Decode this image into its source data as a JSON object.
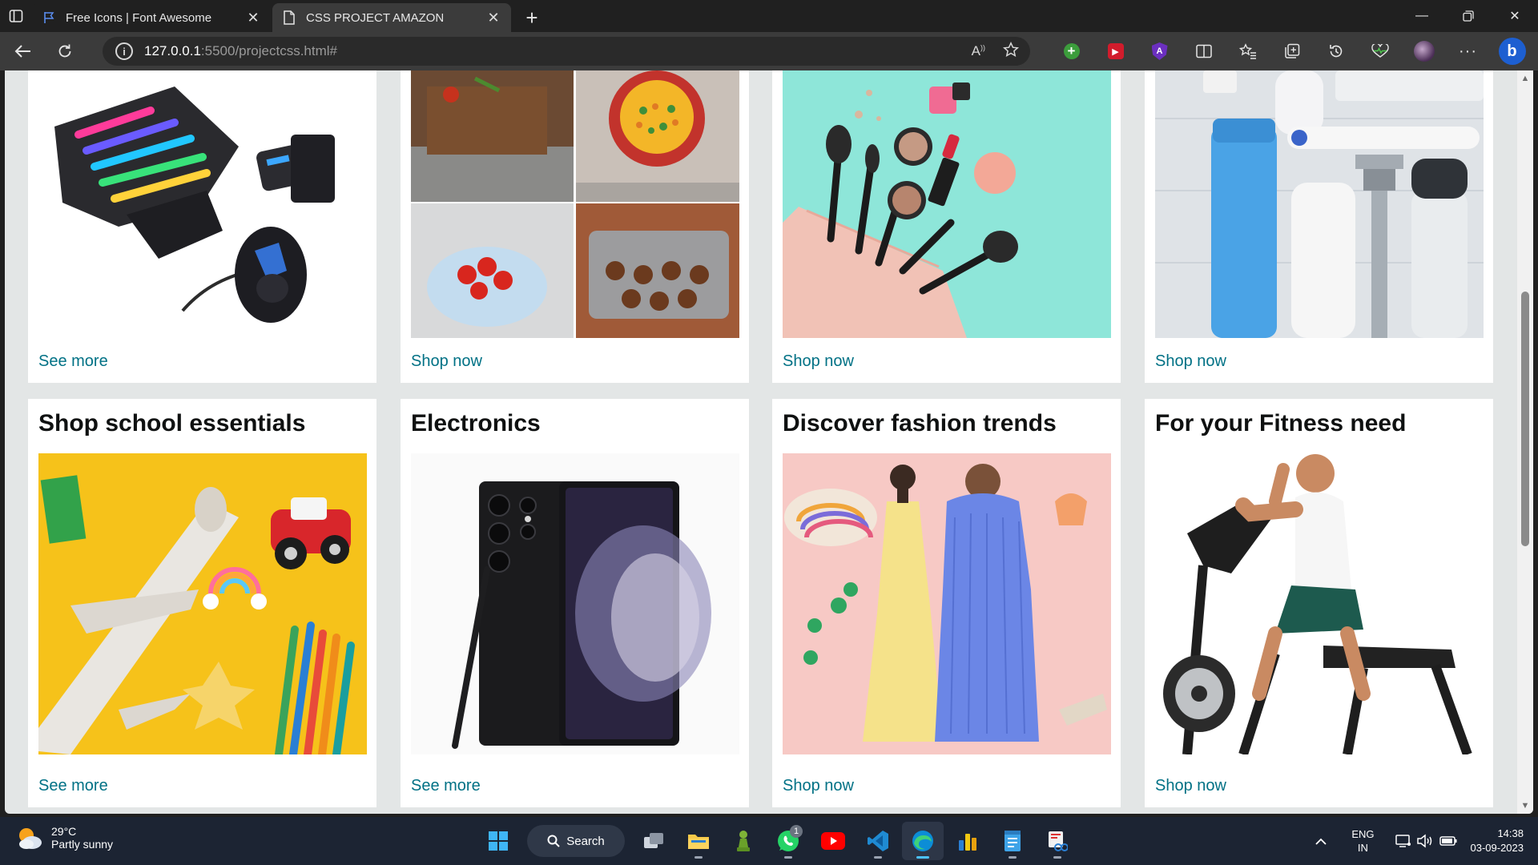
{
  "browser": {
    "tabs": [
      {
        "title": "Free Icons | Font Awesome",
        "active": false
      },
      {
        "title": "CSS PROJECT AMAZON",
        "active": true
      }
    ],
    "address": {
      "host": "127.0.0.1",
      "path": ":5500/projectcss.html#"
    }
  },
  "page": {
    "top_row_links": [
      "See more",
      "Shop now",
      "Shop now",
      "Shop now"
    ],
    "cards": [
      {
        "title": "Shop school essentials",
        "link": "See more"
      },
      {
        "title": "Electronics",
        "link": "See more"
      },
      {
        "title": "Discover fashion trends",
        "link": "Shop now"
      },
      {
        "title": "For your Fitness need",
        "link": "Shop now"
      }
    ],
    "link_color": "#007185",
    "background_color": "#e3e6e6"
  },
  "taskbar": {
    "weather": {
      "temp": "29°C",
      "condition": "Partly sunny"
    },
    "search_label": "Search",
    "whatsapp_badge": "1",
    "language": {
      "line1": "ENG",
      "line2": "IN"
    },
    "clock": {
      "time": "14:38",
      "date": "03-09-2023"
    }
  }
}
